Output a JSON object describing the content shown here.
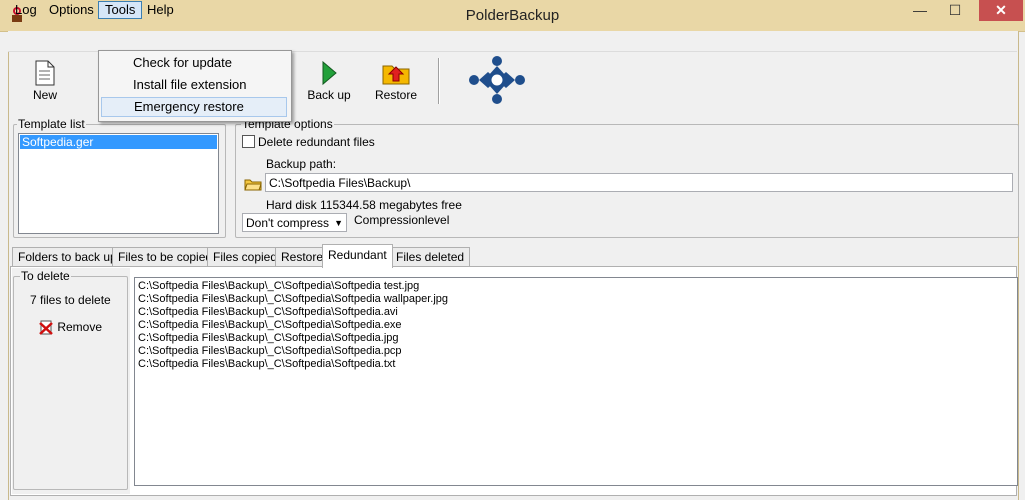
{
  "window": {
    "title": "PolderBackup",
    "minimize": "—",
    "maximize": "☐",
    "close": "✕"
  },
  "menu": {
    "items": [
      "Log",
      "Options",
      "Tools",
      "Help"
    ]
  },
  "dropdown": {
    "items": [
      "Check for update",
      "Install file extension",
      "Emergency restore"
    ]
  },
  "toolbar": {
    "new": "New",
    "backup": "Back up",
    "restore": "Restore"
  },
  "template_list": {
    "legend": "Template list",
    "items": [
      "Softpedia.ger"
    ]
  },
  "template_options": {
    "legend": "Template options",
    "delete_redundant": "Delete redundant files",
    "backup_path_label": "Backup path:",
    "backup_path": "C:\\Softpedia Files\\Backup\\",
    "disk_info": "Hard disk 115344.58 megabytes free",
    "compression_value": "Don't compress",
    "compression_label": "Compressionlevel"
  },
  "tabs": [
    "Folders to back up",
    "Files to be copied",
    "Files copied",
    "Restore",
    "Redundant",
    "Files deleted"
  ],
  "to_delete": {
    "legend": "To delete",
    "count_text": "7 files to delete",
    "remove": "Remove"
  },
  "files": [
    "C:\\Softpedia Files\\Backup\\_C\\Softpedia\\Softpedia test.jpg",
    "C:\\Softpedia Files\\Backup\\_C\\Softpedia\\Softpedia wallpaper.jpg",
    "C:\\Softpedia Files\\Backup\\_C\\Softpedia\\Softpedia.avi",
    "C:\\Softpedia Files\\Backup\\_C\\Softpedia\\Softpedia.exe",
    "C:\\Softpedia Files\\Backup\\_C\\Softpedia\\Softpedia.jpg",
    "C:\\Softpedia Files\\Backup\\_C\\Softpedia\\Softpedia.pcp",
    "C:\\Softpedia Files\\Backup\\_C\\Softpedia\\Softpedia.txt"
  ],
  "colors": {
    "selection": "#3399ff",
    "titlebar": "#e9d7a6",
    "close": "#c75050"
  }
}
